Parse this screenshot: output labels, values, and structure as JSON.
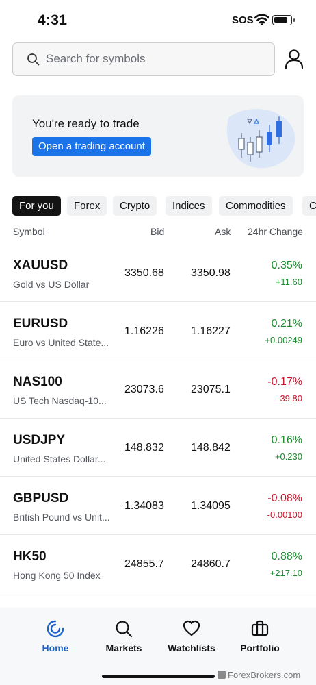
{
  "status_bar": {
    "time": "4:31",
    "sos": "SOS"
  },
  "search": {
    "placeholder": "Search for symbols",
    "value": ""
  },
  "banner": {
    "title": "You're ready to trade",
    "button_label": "Open a trading account"
  },
  "tabs": [
    "For you",
    "Forex",
    "Crypto",
    "Indices",
    "Commodities",
    "C"
  ],
  "columns": {
    "symbol": "Symbol",
    "bid": "Bid",
    "ask": "Ask",
    "change": "24hr Change"
  },
  "rows": [
    {
      "symbol": "XAUUSD",
      "description": "Gold vs US Dollar",
      "bid": "3350.68",
      "ask": "3350.98",
      "change_pct": "0.35%",
      "change_abs": "+11.60",
      "direction": "up"
    },
    {
      "symbol": "EURUSD",
      "description": "Euro vs United State...",
      "bid": "1.16226",
      "ask": "1.16227",
      "change_pct": "0.21%",
      "change_abs": "+0.00249",
      "direction": "up"
    },
    {
      "symbol": "NAS100",
      "description": "US Tech Nasdaq-10...",
      "bid": "23073.6",
      "ask": "23075.1",
      "change_pct": "-0.17%",
      "change_abs": "-39.80",
      "direction": "down"
    },
    {
      "symbol": "USDJPY",
      "description": "United States Dollar...",
      "bid": "148.832",
      "ask": "148.842",
      "change_pct": "0.16%",
      "change_abs": "+0.230",
      "direction": "up"
    },
    {
      "symbol": "GBPUSD",
      "description": "British Pound vs Unit...",
      "bid": "1.34083",
      "ask": "1.34095",
      "change_pct": "-0.08%",
      "change_abs": "-0.00100",
      "direction": "down"
    },
    {
      "symbol": "HK50",
      "description": "Hong Kong 50 Index",
      "bid": "24855.7",
      "ask": "24860.7",
      "change_pct": "0.88%",
      "change_abs": "+217.10",
      "direction": "up"
    }
  ],
  "bottom_nav": [
    {
      "label": "Home",
      "icon": "home-swirl-icon",
      "active": true
    },
    {
      "label": "Markets",
      "icon": "search-icon",
      "active": false
    },
    {
      "label": "Watchlists",
      "icon": "heart-icon",
      "active": false
    },
    {
      "label": "Portfolio",
      "icon": "briefcase-icon",
      "active": false
    }
  ],
  "watermark": "ForexBrokers.com",
  "colors": {
    "accent": "#1a73e8",
    "nav_active": "#1a63c9",
    "positive": "#1d8a2e",
    "negative": "#c7162b",
    "active_tab": "#141414"
  }
}
